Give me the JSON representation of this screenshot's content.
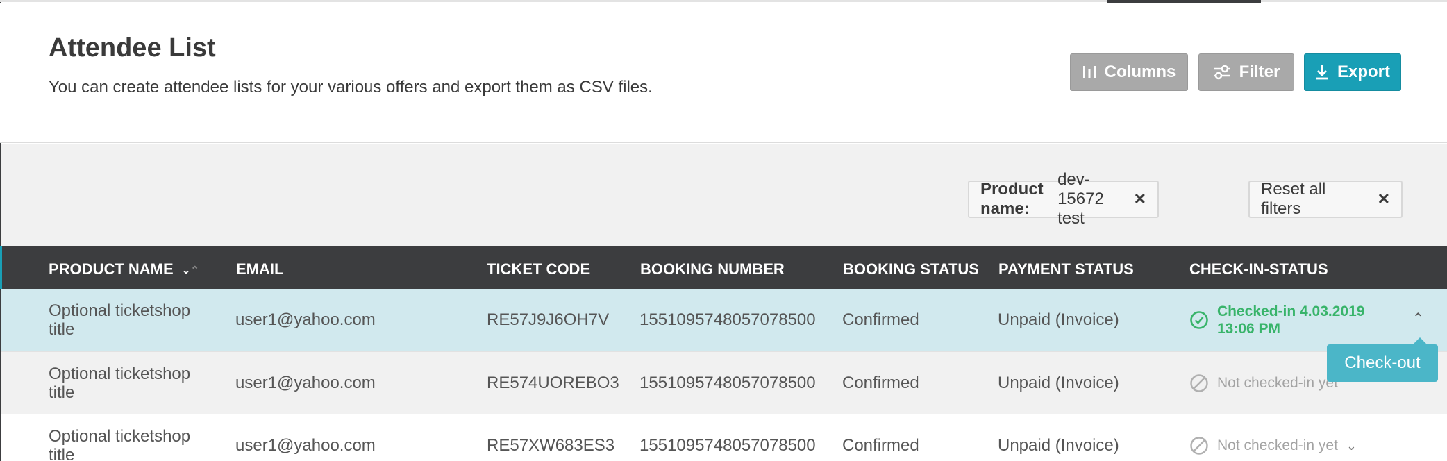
{
  "header": {
    "title": "Attendee List",
    "description": "You can create attendee lists for your various offers and export them as CSV files."
  },
  "toolbar": {
    "columns_label": "Columns",
    "filter_label": "Filter",
    "export_label": "Export"
  },
  "filters": {
    "active": [
      {
        "field": "Product name:",
        "value": "dev-15672 test"
      }
    ],
    "reset_label": "Reset all filters"
  },
  "table": {
    "columns": [
      "PRODUCT NAME",
      "EMAIL",
      "TICKET CODE",
      "BOOKING NUMBER",
      "BOOKING STATUS",
      "PAYMENT STATUS",
      "CHECK-IN-STATUS"
    ],
    "rows": [
      {
        "product": "Optional ticketshop title",
        "email": "user1@yahoo.com",
        "ticket_code": "RE57J9J6OH7V",
        "booking_number": "1551095748057078500",
        "booking_status": "Confirmed",
        "payment_status": "Unpaid (Invoice)",
        "checkin_status": "Checked-in 4.03.2019 13:06 PM",
        "checked_in": true
      },
      {
        "product": "Optional ticketshop title",
        "email": "user1@yahoo.com",
        "ticket_code": "RE574UOREBO3",
        "booking_number": "1551095748057078500",
        "booking_status": "Confirmed",
        "payment_status": "Unpaid (Invoice)",
        "checkin_status": "Not checked-in yet",
        "checked_in": false
      },
      {
        "product": "Optional ticketshop title",
        "email": "user1@yahoo.com",
        "ticket_code": "RE57XW683ES3",
        "booking_number": "1551095748057078500",
        "booking_status": "Confirmed",
        "payment_status": "Unpaid (Invoice)",
        "checkin_status": "Not checked-in yet",
        "checked_in": false
      }
    ]
  },
  "tooltip": {
    "label": "Check-out"
  },
  "colors": {
    "accent": "#199fb6",
    "header_dark": "#3c3d3f",
    "checked_in": "#38b46a",
    "selected_row": "#d1e9ee"
  },
  "icons": {
    "columns": "columns-icon",
    "filter": "sliders-icon",
    "export": "download-icon",
    "close": "close-icon",
    "checked": "check-circle-icon",
    "not_checked": "blocked-circle-icon"
  }
}
